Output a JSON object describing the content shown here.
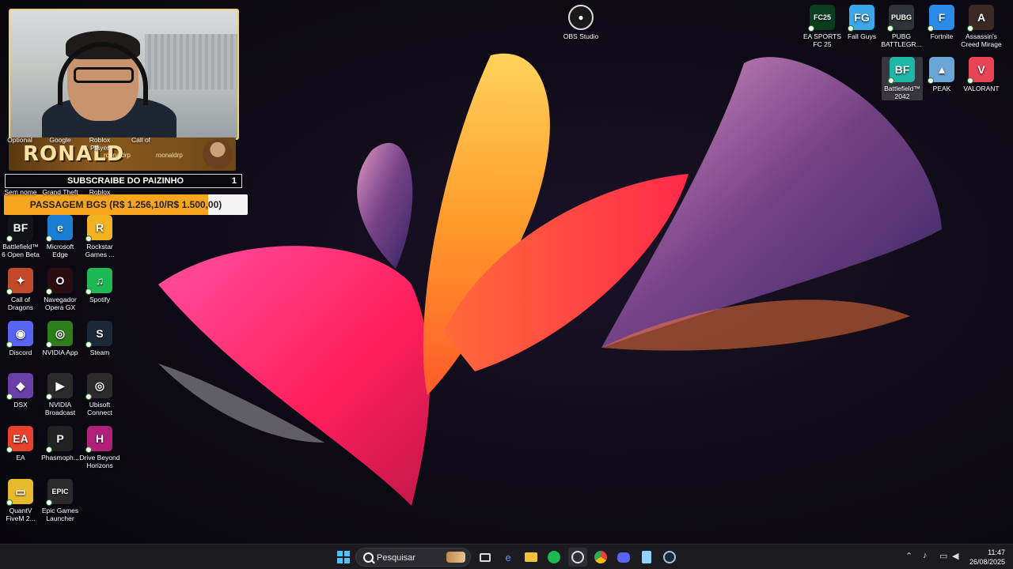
{
  "overlay": {
    "streamer_name": "RONALD",
    "handle_1": "roonaldrp",
    "handle_2": "roonaldrp",
    "subscribe_label": "SUBSCRAIBE DO PAIZINHO",
    "subscribe_count": "1",
    "goal_label": "PASSAGEM BGS (R$ 1.256,10/R$ 1.500,00)",
    "goal_progress": 0.837
  },
  "hidden_labels": {
    "l1": "Optional",
    "l2": "Google",
    "l3": "Roblox Player",
    "l4": "Call of",
    "l5": "Sem nome",
    "l6": "Grand Theft",
    "l7": "Roblox"
  },
  "desktop": {
    "obs": "OBS Studio",
    "right_icons": [
      {
        "label": "EA SPORTS FC 25",
        "glyph": "FC25",
        "color": "#0b3d1f"
      },
      {
        "label": "Fall Guys",
        "glyph": "FG",
        "color": "#3aa7e8"
      },
      {
        "label": "PUBG BATTLEGR...",
        "glyph": "PUBG",
        "color": "#2f3238"
      },
      {
        "label": "Fortnite",
        "glyph": "F",
        "color": "#2c8ae8"
      },
      {
        "label": "Assassin's Creed Mirage",
        "glyph": "A",
        "color": "#3b2a22"
      },
      {
        "label": "Battlefield™ 2042",
        "glyph": "BF",
        "color": "#1fb8a8"
      },
      {
        "label": "PEAK",
        "glyph": "▲",
        "color": "#6aa5d8"
      },
      {
        "label": "VALORANT",
        "glyph": "V",
        "color": "#e84456"
      }
    ],
    "left_icons": [
      {
        "label": "Battlefield™ 6 Open Beta",
        "glyph": "BF",
        "color": "#111318"
      },
      {
        "label": "Microsoft Edge",
        "glyph": "e",
        "color": "#1a7fd4"
      },
      {
        "label": "Rockstar Games ...",
        "glyph": "R",
        "color": "#f2b321"
      },
      {
        "label": "Call of Dragons",
        "glyph": "✦",
        "color": "#c24a2a"
      },
      {
        "label": "Navegador Opera GX",
        "glyph": "O",
        "color": "#2a0c12"
      },
      {
        "label": "Spotify",
        "glyph": "♫",
        "color": "#1db954"
      },
      {
        "label": "Discord",
        "glyph": "◉",
        "color": "#5865f2"
      },
      {
        "label": "NVIDIA App",
        "glyph": "◎",
        "color": "#2e7d1a"
      },
      {
        "label": "Steam",
        "glyph": "S",
        "color": "#1b2838"
      },
      {
        "label": "DSX",
        "glyph": "◆",
        "color": "#6a3fa8"
      },
      {
        "label": "NVIDIA Broadcast",
        "glyph": "▶",
        "color": "#2a2a2a"
      },
      {
        "label": "Ubisoft Connect",
        "glyph": "◎",
        "color": "#2b2b2b"
      },
      {
        "label": "EA",
        "glyph": "EA",
        "color": "#e8412c"
      },
      {
        "label": "Phasmoph...",
        "glyph": "P",
        "color": "#222"
      },
      {
        "label": "Drive Beyond Horizons",
        "glyph": "H",
        "color": "#b0207a"
      },
      {
        "label": "QuantV FiveM 2...",
        "glyph": "▭",
        "color": "#e8b92c"
      },
      {
        "label": "Epic Games Launcher",
        "glyph": "EPIC",
        "color": "#2a2a2a"
      }
    ]
  },
  "taskbar": {
    "search_placeholder": "Pesquisar",
    "time": "11:47",
    "date": "26/08/2025"
  },
  "colors": {
    "goal_fill": "#f7a51f",
    "taskbar": "#1c1c20"
  }
}
